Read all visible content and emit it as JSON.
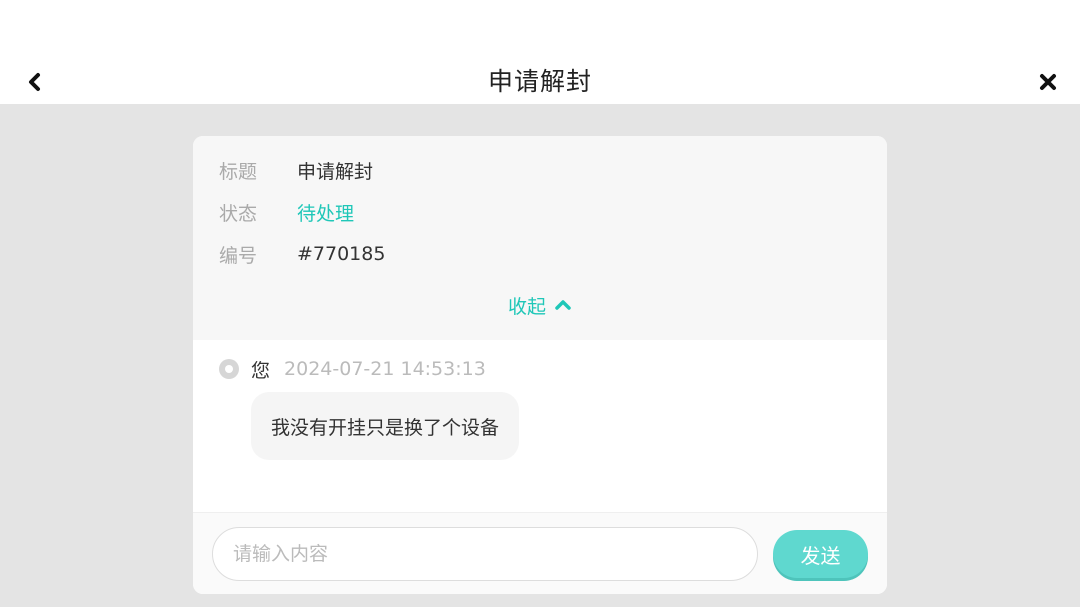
{
  "header": {
    "title": "申请解封",
    "back_icon": "chevron-left-icon",
    "close_icon": "close-icon"
  },
  "ticket": {
    "title_label": "标题",
    "title_value": "申请解封",
    "status_label": "状态",
    "status_value": "待处理",
    "number_label": "编号",
    "number_value": "#770185",
    "collapse_label": "收起",
    "collapse_icon": "chevron-up-icon"
  },
  "messages": [
    {
      "sender": "您",
      "time": "2024-07-21 14:53:13",
      "text": "我没有开挂只是换了个设备"
    }
  ],
  "composer": {
    "placeholder": "请输入内容",
    "value": "",
    "send_label": "发送"
  },
  "colors": {
    "accent": "#1fc7b8",
    "send_button": "#5fd8cf",
    "background": "#e4e4e4"
  }
}
